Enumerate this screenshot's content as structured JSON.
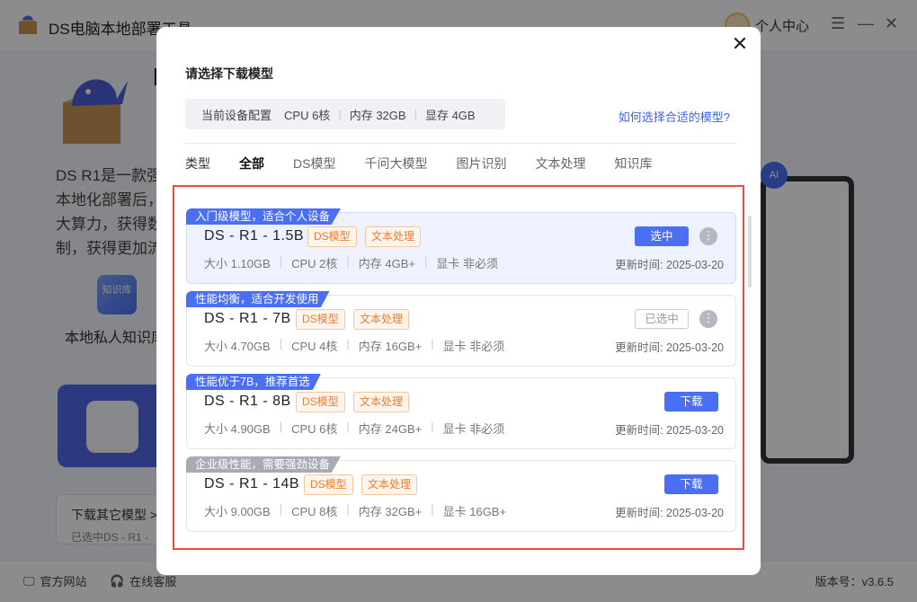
{
  "app": {
    "title": "DS电脑本地部署工具",
    "user_center": "个人中心",
    "hero_title": "D",
    "hero_desc": "DS R1是一款强大算力，获得数制，获得更加流",
    "hero_desc_lines": [
      "DS R1是一款强",
      "本地化部署后，",
      "大算力，获得数",
      "制，获得更加流"
    ],
    "kb_icon_text": "知识库",
    "kb_label": "本地私人知识库",
    "other_models_title": "下载其它模型 >",
    "other_models_sub": "已选中DS - R1 -",
    "official_site": "官方网站",
    "online_service": "在线客服",
    "version": "版本号：v3.6.5"
  },
  "modal": {
    "title": "请选择下载模型",
    "config": {
      "label": "当前设备配置",
      "cpu": "CPU 6核",
      "memory": "内存 32GB",
      "gpu": "显存 4GB"
    },
    "help_link": "如何选择合适的模型?",
    "tabs": {
      "type_label": "类型",
      "items": [
        "全部",
        "DS模型",
        "千问大模型",
        "图片识别",
        "文本处理",
        "知识库"
      ],
      "active": "全部"
    },
    "models": [
      {
        "ribbon": "入门级模型，适合个人设备",
        "name": "DS - R1 - 1.5B",
        "tags": [
          "DS模型",
          "文本处理"
        ],
        "size": "大小 1.10GB",
        "cpu": "CPU 2核",
        "memory": "内存 4GB+",
        "gpu": "显卡 非必须",
        "updated": "更新时间:  2025-03-20",
        "action": "选中"
      },
      {
        "ribbon": "性能均衡，适合开发使用",
        "name": "DS - R1 - 7B",
        "tags": [
          "DS模型",
          "文本处理"
        ],
        "size": "大小 4.70GB",
        "cpu": "CPU 4核",
        "memory": "内存 16GB+",
        "gpu": "显卡 非必须",
        "updated": "更新时间:  2025-03-20",
        "action": "已选中"
      },
      {
        "ribbon": "性能优于7B，推荐首选",
        "name": "DS - R1 - 8B",
        "tags": [
          "DS模型",
          "文本处理"
        ],
        "size": "大小 4.90GB",
        "cpu": "CPU 6核",
        "memory": "内存 24GB+",
        "gpu": "显卡 非必须",
        "updated": "更新时间:  2025-03-20",
        "action": "下载"
      },
      {
        "ribbon": "企业级性能，需要强劲设备",
        "name": "DS - R1 - 14B",
        "tags": [
          "DS模型",
          "文本处理"
        ],
        "size": "大小 9.00GB",
        "cpu": "CPU 8核",
        "memory": "内存 32GB+",
        "gpu": "显卡 16GB+",
        "updated": "更新时间:  2025-03-20",
        "action": "下载"
      }
    ]
  },
  "colors": {
    "accent": "#4a6ff5",
    "tag_orange": "#ef7b2d",
    "highlight_border": "#e74c3c"
  }
}
